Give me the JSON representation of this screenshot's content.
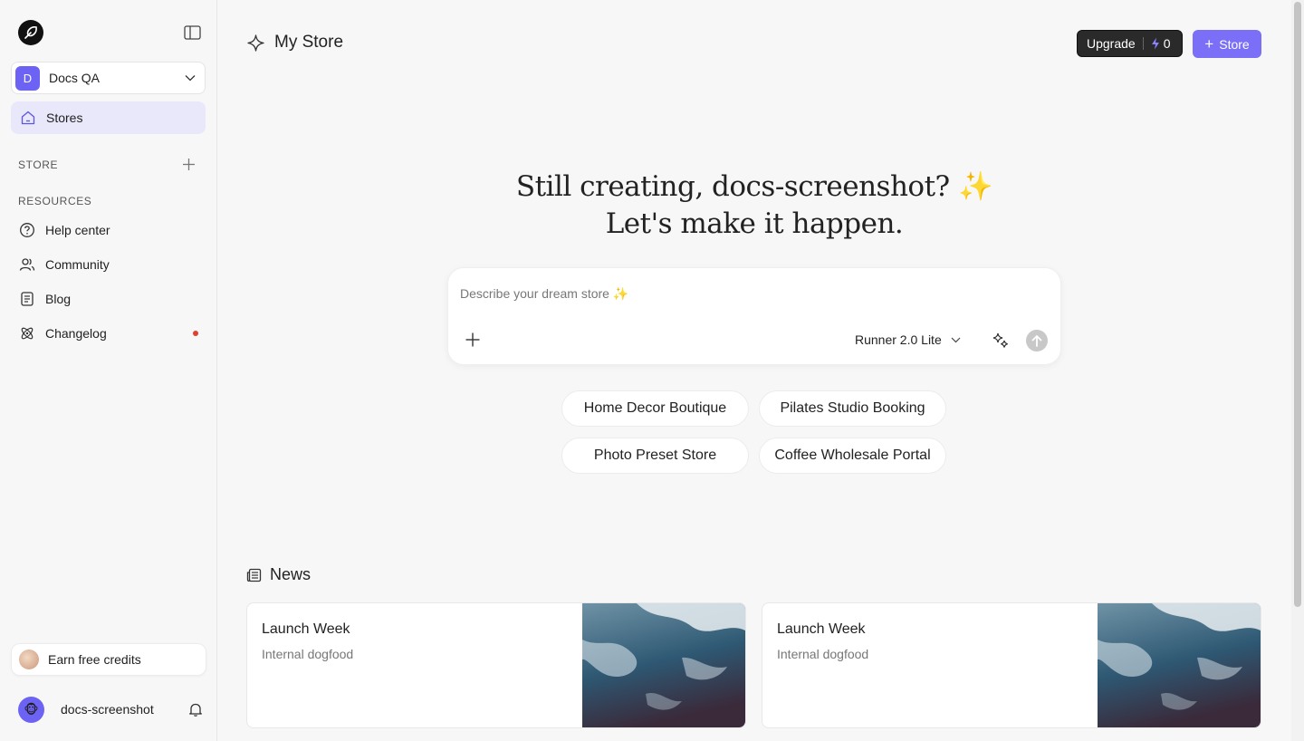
{
  "sidebar": {
    "workspace": {
      "initial": "D",
      "name": "Docs QA"
    },
    "nav_active": {
      "label": "Stores"
    },
    "store_section": "STORE",
    "resources_section": "RESOURCES",
    "resources": [
      {
        "label": "Help center",
        "icon": "help-circle-icon"
      },
      {
        "label": "Community",
        "icon": "users-icon"
      },
      {
        "label": "Blog",
        "icon": "document-icon"
      },
      {
        "label": "Changelog",
        "icon": "atom-icon",
        "has_dot": true
      }
    ],
    "earn_credits": "Earn free credits",
    "user": {
      "name": "docs-screenshot",
      "avatar": "🐵"
    }
  },
  "header": {
    "title": "My Store",
    "upgrade_label": "Upgrade",
    "credits": "0",
    "new_store_label": "Store"
  },
  "hero": {
    "line1": "Still creating, docs-screenshot? ✨",
    "line2": "Let's make it happen."
  },
  "composer": {
    "placeholder": "Describe your dream store ✨",
    "model": "Runner 2.0 Lite"
  },
  "suggestions": [
    "Home Decor Boutique",
    "Pilates Studio Booking",
    "Photo Preset Store",
    "Coffee Wholesale Portal"
  ],
  "news": {
    "title": "News",
    "cards": [
      {
        "title": "Launch Week",
        "subtitle": "Internal dogfood"
      },
      {
        "title": "Launch Week",
        "subtitle": "Internal dogfood"
      }
    ]
  },
  "colors": {
    "accent": "#7a6ff6",
    "active_nav": "#e9e8fa",
    "dot": "#e0402f"
  }
}
